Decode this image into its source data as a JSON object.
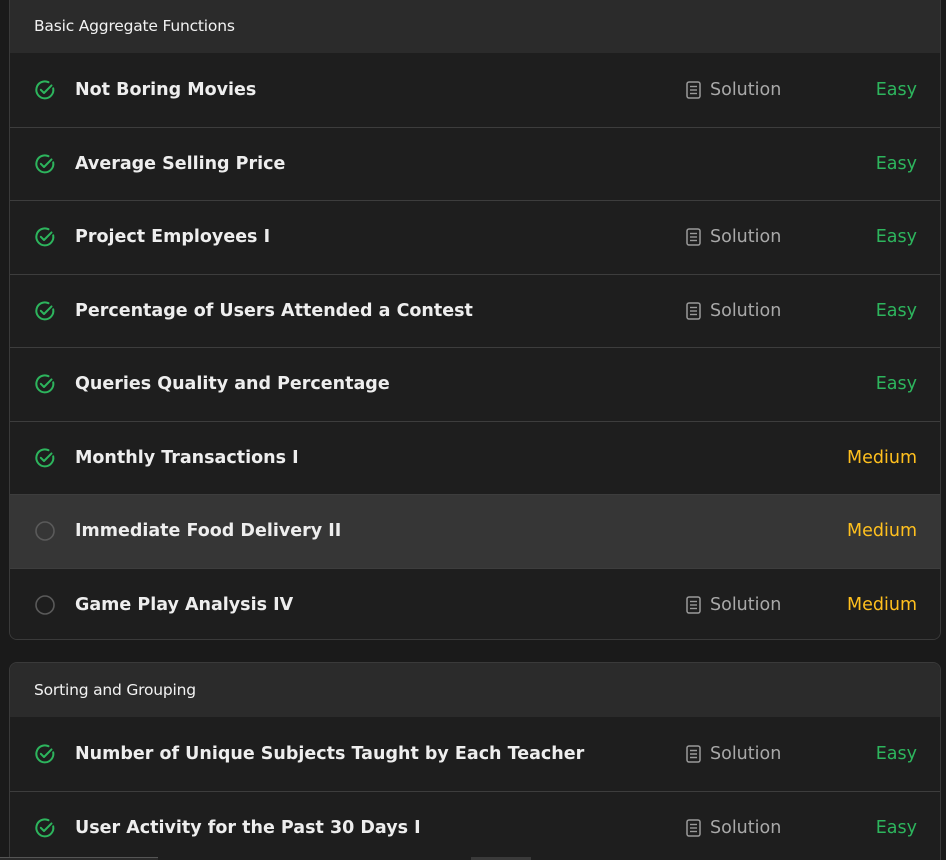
{
  "colors": {
    "easy": "#2db55d",
    "medium": "#ffc01e",
    "solved": "#2db55d",
    "unsolved": "#5a5a5a"
  },
  "sections": [
    {
      "title": "Basic Aggregate Functions",
      "problems": [
        {
          "title": "Not Boring Movies",
          "status": "solved",
          "has_solution": true,
          "solution_label": "Solution",
          "difficulty": "Easy"
        },
        {
          "title": "Average Selling Price",
          "status": "solved",
          "has_solution": false,
          "solution_label": "",
          "difficulty": "Easy"
        },
        {
          "title": "Project Employees I",
          "status": "solved",
          "has_solution": true,
          "solution_label": "Solution",
          "difficulty": "Easy"
        },
        {
          "title": "Percentage of Users Attended a Contest",
          "status": "solved",
          "has_solution": true,
          "solution_label": "Solution",
          "difficulty": "Easy"
        },
        {
          "title": "Queries Quality and Percentage",
          "status": "solved",
          "has_solution": false,
          "solution_label": "",
          "difficulty": "Easy"
        },
        {
          "title": "Monthly Transactions I",
          "status": "solved",
          "has_solution": false,
          "solution_label": "",
          "difficulty": "Medium"
        },
        {
          "title": "Immediate Food Delivery II",
          "status": "unsolved",
          "has_solution": false,
          "solution_label": "",
          "difficulty": "Medium",
          "highlighted": true
        },
        {
          "title": "Game Play Analysis IV",
          "status": "unsolved",
          "has_solution": true,
          "solution_label": "Solution",
          "difficulty": "Medium"
        }
      ]
    },
    {
      "title": "Sorting and Grouping",
      "problems": [
        {
          "title": "Number of Unique Subjects Taught by Each Teacher",
          "status": "solved",
          "has_solution": true,
          "solution_label": "Solution",
          "difficulty": "Easy"
        },
        {
          "title": "User Activity for the Past 30 Days I",
          "status": "solved",
          "has_solution": true,
          "solution_label": "Solution",
          "difficulty": "Easy"
        }
      ]
    }
  ]
}
